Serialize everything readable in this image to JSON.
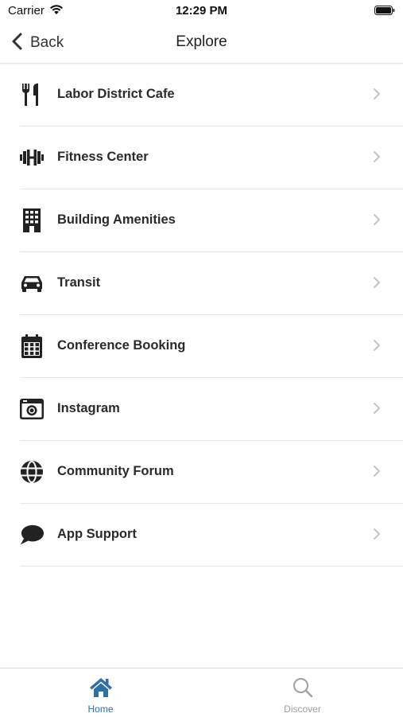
{
  "status_bar": {
    "carrier": "Carrier",
    "time": "12:29 PM"
  },
  "nav": {
    "back_label": "Back",
    "title": "Explore"
  },
  "menu": [
    {
      "label": "Labor District Cafe",
      "icon": "utensils-icon"
    },
    {
      "label": "Fitness Center",
      "icon": "dumbbell-icon"
    },
    {
      "label": "Building Amenities",
      "icon": "building-icon"
    },
    {
      "label": "Transit",
      "icon": "car-icon"
    },
    {
      "label": "Conference Booking",
      "icon": "calendar-icon"
    },
    {
      "label": "Instagram",
      "icon": "camera-icon"
    },
    {
      "label": "Community Forum",
      "icon": "globe-icon"
    },
    {
      "label": "App Support",
      "icon": "chat-bubble-icon"
    }
  ],
  "tabs": [
    {
      "label": "Home",
      "icon": "home-icon",
      "active": true
    },
    {
      "label": "Discover",
      "icon": "search-icon",
      "active": false
    }
  ],
  "colors": {
    "accent": "#2f6fa8",
    "inactive": "#a0a0a0",
    "icon": "#222222",
    "chevron": "#c4c4c4"
  }
}
